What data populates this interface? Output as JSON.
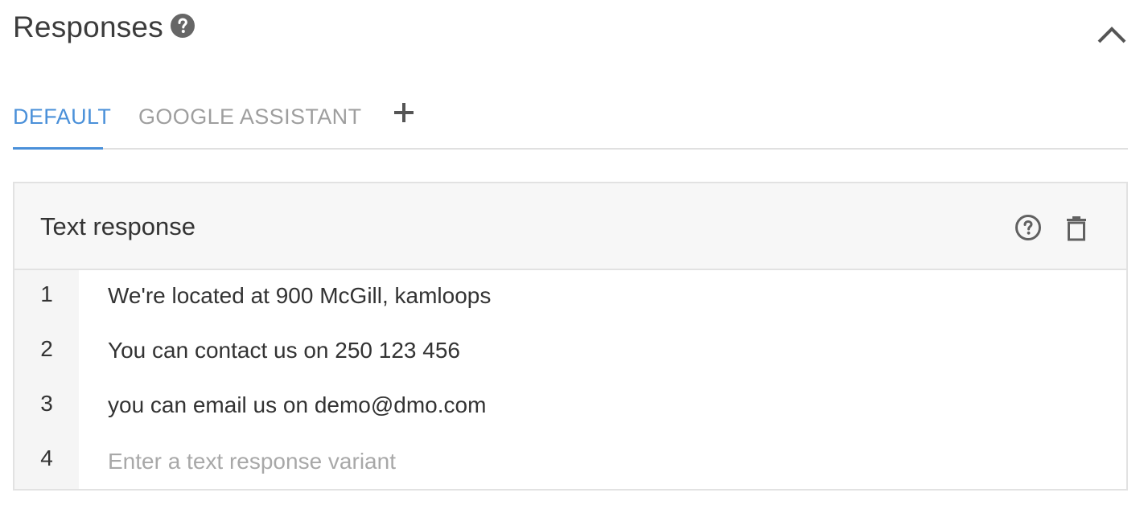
{
  "section": {
    "title": "Responses"
  },
  "tabs": [
    {
      "label": "DEFAULT",
      "active": true
    },
    {
      "label": "GOOGLE ASSISTANT",
      "active": false
    }
  ],
  "card": {
    "title": "Text response",
    "rows": [
      {
        "num": "1",
        "text": "We're located at 900 McGill, kamloops"
      },
      {
        "num": "2",
        "text": "You can contact us on 250 123 456"
      },
      {
        "num": "3",
        "text": "you can email us on demo@dmo.com"
      }
    ],
    "input_row": {
      "num": "4",
      "placeholder": "Enter a text response variant"
    }
  },
  "icons": {
    "section_help": "help-circle-filled-icon",
    "collapse": "chevron-up-icon",
    "add_tab": "plus-icon",
    "card_help": "help-circle-outline-icon",
    "card_delete": "trash-icon"
  },
  "colors": {
    "accent": "#4a90d9",
    "text": "#333333",
    "muted": "#9e9e9e"
  }
}
